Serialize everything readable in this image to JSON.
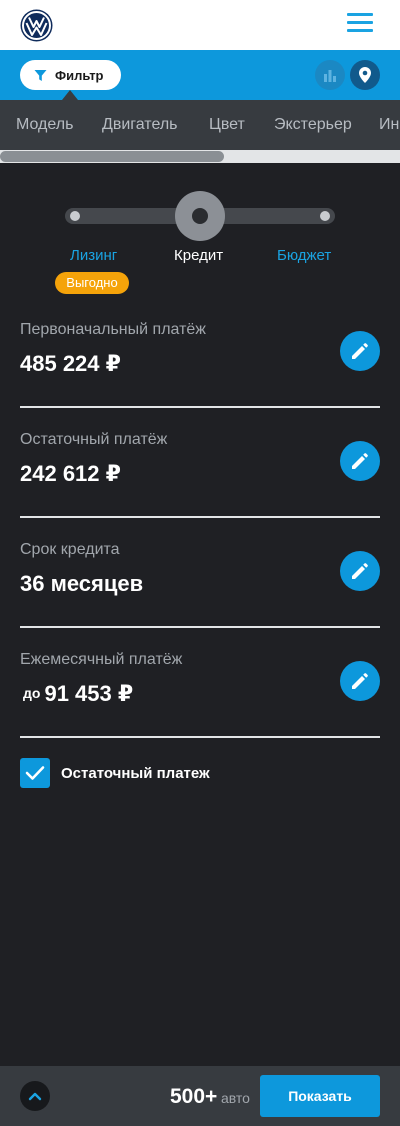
{
  "header": {
    "logo_icon": "volkswagen-logo",
    "menu_icon": "hamburger-menu-icon"
  },
  "filterbar": {
    "filter_label": "Фильтр",
    "filter_icon": "funnel-icon",
    "chart_icon": "bar-chart-icon",
    "map_icon": "map-pin-icon"
  },
  "tabs": [
    "Модель",
    "Двигатель",
    "Цвет",
    "Экстерьер",
    "Ин"
  ],
  "payment_mode": {
    "options": [
      "Лизинг",
      "Кредит",
      "Бюджет"
    ],
    "selected": "Кредит",
    "badge": "Выгодно"
  },
  "fields": [
    {
      "label": "Первоначальный платёж",
      "prefix": "",
      "value": "485 224 ₽"
    },
    {
      "label": "Остаточный платёж",
      "prefix": "",
      "value": "242 612 ₽"
    },
    {
      "label": "Срок кредита",
      "prefix": "",
      "value": "36 месяцев"
    },
    {
      "label": "Ежемесячный платёж",
      "prefix": "до",
      "value": "91 453 ₽"
    }
  ],
  "residual_checkbox": {
    "label": "Остаточный платеж",
    "checked": true
  },
  "bottom_bar": {
    "count": "500+",
    "count_unit": "авто",
    "show_label": "Показать"
  },
  "colors": {
    "accent": "#0d98dc",
    "badge": "#f5a30a",
    "background": "#1f2024",
    "tabbar": "#373b40"
  }
}
